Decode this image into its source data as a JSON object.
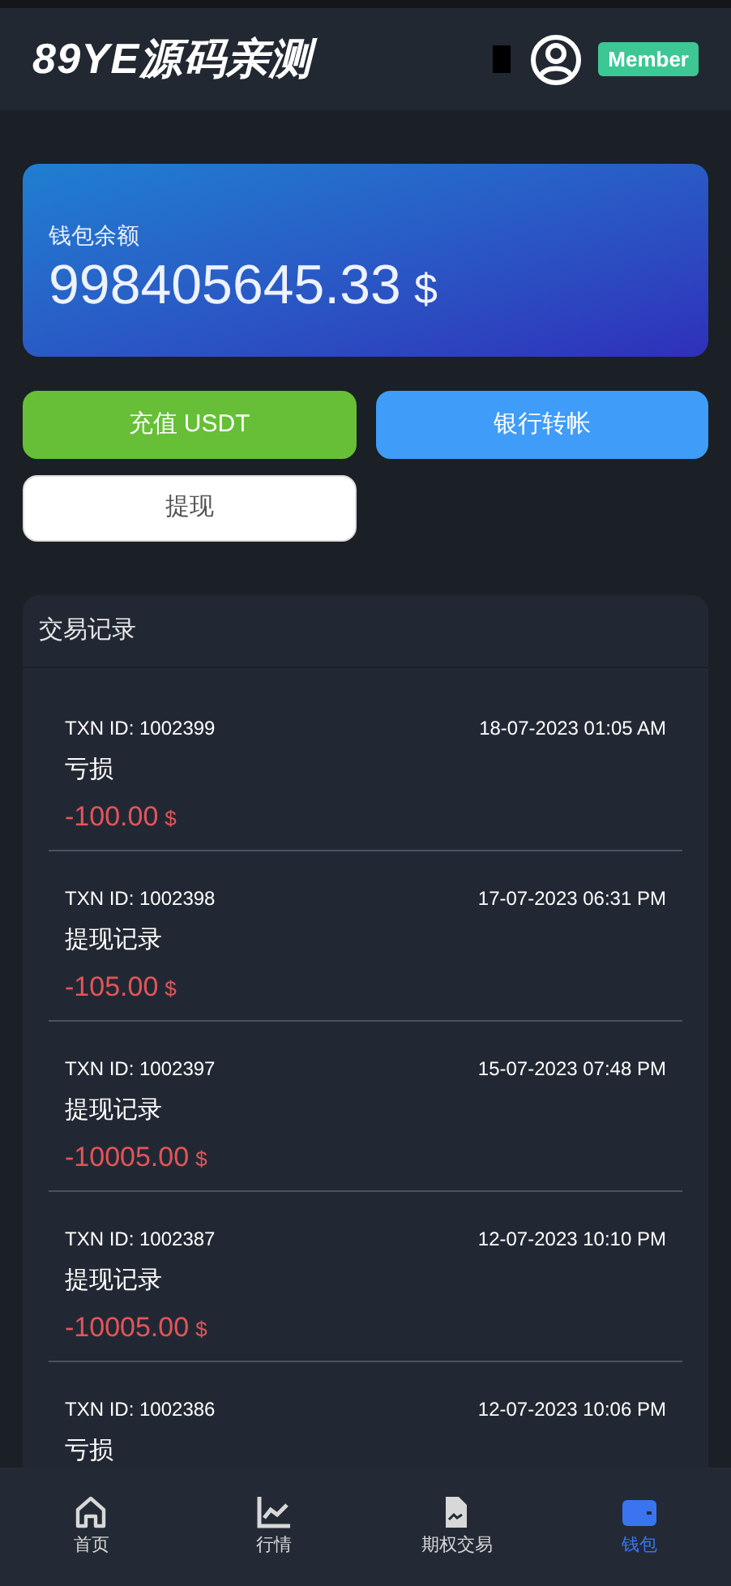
{
  "header": {
    "logo": "89YE源码亲测",
    "badge": "Member"
  },
  "wallet": {
    "label": "钱包余额",
    "balance": "998405645.33",
    "currency": "$"
  },
  "actions": [
    {
      "label": "充值 USDT",
      "kind": "green"
    },
    {
      "label": "银行转帐",
      "kind": "blue"
    },
    {
      "label": "提现",
      "kind": "white"
    }
  ],
  "transactions": {
    "title": "交易记录",
    "items": [
      {
        "txn": "TXN ID: 1002399",
        "date": "18-07-2023 01:05 AM",
        "type": "亏损",
        "amount": "-100.00",
        "currency": "$"
      },
      {
        "txn": "TXN ID: 1002398",
        "date": "17-07-2023 06:31 PM",
        "type": "提现记录",
        "amount": "-105.00",
        "currency": "$"
      },
      {
        "txn": "TXN ID: 1002397",
        "date": "15-07-2023 07:48 PM",
        "type": "提现记录",
        "amount": "-10005.00",
        "currency": "$"
      },
      {
        "txn": "TXN ID: 1002387",
        "date": "12-07-2023 10:10 PM",
        "type": "提现记录",
        "amount": "-10005.00",
        "currency": "$"
      },
      {
        "txn": "TXN ID: 1002386",
        "date": "12-07-2023 10:06 PM",
        "type": "亏损"
      }
    ]
  },
  "nav": [
    {
      "label": "首页",
      "kind": "home",
      "selected": false
    },
    {
      "label": "行情",
      "kind": "chart",
      "selected": false
    },
    {
      "label": "期权交易",
      "kind": "doc",
      "selected": false
    },
    {
      "label": "钱包",
      "kind": "wallet",
      "selected": true
    }
  ]
}
